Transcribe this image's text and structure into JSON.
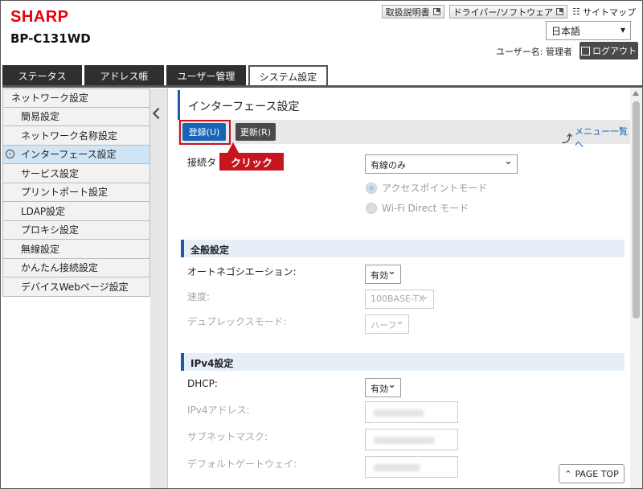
{
  "header": {
    "brand": "SHARP",
    "model": "BP-C131WD",
    "links": [
      {
        "label": "取扱説明書"
      },
      {
        "label": "ドライバー/ソフトウェア"
      }
    ],
    "sitemap_label": "サイトマップ",
    "language": "日本語",
    "user_label": "ユーザー名: 管理者",
    "logout_label": "ログアウト"
  },
  "tabs": [
    {
      "label": "ステータス"
    },
    {
      "label": "アドレス帳"
    },
    {
      "label": "ユーザー管理"
    },
    {
      "label": "システム設定"
    }
  ],
  "sidebar": {
    "header": "ネットワーク設定",
    "items": [
      {
        "label": "簡易設定"
      },
      {
        "label": "ネットワーク名称設定"
      },
      {
        "label": "インターフェース設定"
      },
      {
        "label": "サービス設定"
      },
      {
        "label": "プリントポート設定"
      },
      {
        "label": "LDAP設定"
      },
      {
        "label": "プロキシ設定"
      },
      {
        "label": "無線設定"
      },
      {
        "label": "かんたん接続設定"
      },
      {
        "label": "デバイスWebページ設定"
      }
    ]
  },
  "main": {
    "title": "インターフェース設定",
    "save_label": "登録(U)",
    "refresh_label": "更新(R)",
    "menu_link": "メニュー一覧へ",
    "callout": "クリック",
    "connection": {
      "label": "接続タ",
      "value": "有線のみ",
      "radio_ap": "アクセスポイントモード",
      "radio_wifi": "Wi-Fi Direct モード"
    },
    "general": {
      "title": "全般設定",
      "autoneg_label": "オートネゴシエーション:",
      "autoneg_value": "有効",
      "speed_label": "速度:",
      "speed_value": "100BASE-TX",
      "duplex_label": "デュプレックスモード:",
      "duplex_value": "ハーフ"
    },
    "ipv4": {
      "title": "IPv4設定",
      "dhcp_label": "DHCP:",
      "dhcp_value": "有効",
      "ip_label": "IPv4アドレス:",
      "mask_label": "サブネットマスク:",
      "gateway_label": "デフォルトゲートウェイ:"
    },
    "pagetop": "PAGE TOP"
  },
  "colors": {
    "brand_red": "#e8000b",
    "primary_blue": "#1a64b8",
    "highlight_red": "#c8141e"
  }
}
